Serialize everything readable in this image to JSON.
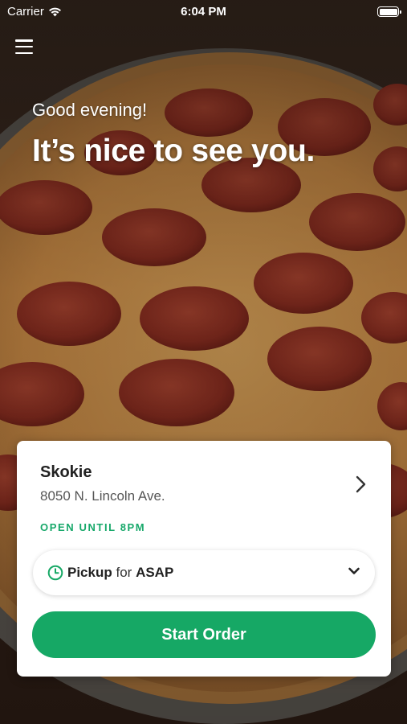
{
  "status_bar": {
    "carrier": "Carrier",
    "time": "6:04 PM",
    "icons": [
      "wifi-icon",
      "battery-icon"
    ]
  },
  "header": {
    "menu_icon": "hamburger-menu-icon"
  },
  "hero": {
    "greeting": "Good evening!",
    "headline": "It’s nice to see you.",
    "background": "pepperoni pizza photo"
  },
  "store_card": {
    "name": "Skokie",
    "address": "8050 N. Lincoln Ave.",
    "hours": "OPEN UNTIL 8PM",
    "order_mode": {
      "mode": "Pickup",
      "connector": "for",
      "time": "ASAP"
    },
    "cta_label": "Start Order"
  },
  "colors": {
    "accent_green": "#16a865",
    "hours_green": "#17a86a",
    "card_bg": "#ffffff"
  }
}
